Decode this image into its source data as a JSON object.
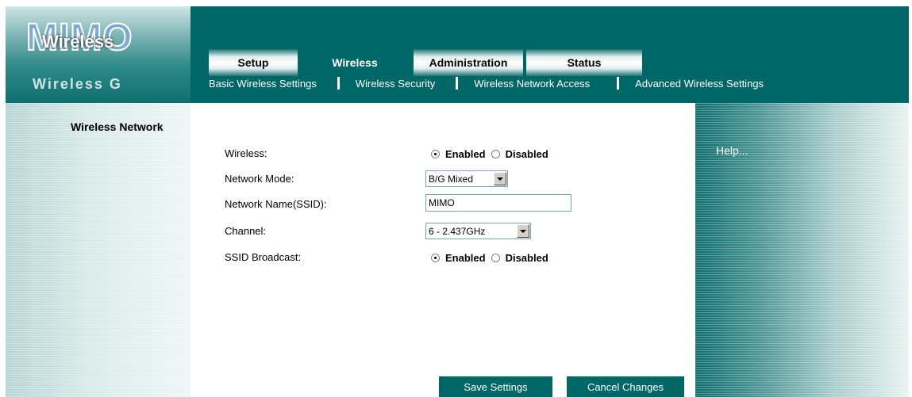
{
  "logo": {
    "big_text": "MIMO",
    "overlay_text": "Wireless",
    "subtitle": "Wireless G"
  },
  "tabs": [
    {
      "label": "Setup",
      "active": false
    },
    {
      "label": "Wireless",
      "active": true
    },
    {
      "label": "Administration",
      "active": false
    },
    {
      "label": "Status",
      "active": false
    }
  ],
  "subnav": [
    "Basic Wireless Settings",
    "Wireless Security",
    "Wireless Network Access",
    "Advanced Wireless Settings"
  ],
  "section_title": "Wireless Network",
  "help_label": "Help...",
  "form": {
    "wireless": {
      "label": "Wireless:",
      "options": [
        "Enabled",
        "Disabled"
      ],
      "selected": "Enabled"
    },
    "network_mode": {
      "label": "Network Mode:",
      "value": "B/G Mixed"
    },
    "ssid": {
      "label": "Network Name(SSID):",
      "value": "MIMO"
    },
    "channel": {
      "label": "Channel:",
      "value": "6 - 2.437GHz"
    },
    "ssid_broadcast": {
      "label": "SSID Broadcast:",
      "options": [
        "Enabled",
        "Disabled"
      ],
      "selected": "Enabled"
    }
  },
  "buttons": {
    "save": "Save Settings",
    "cancel": "Cancel Changes"
  },
  "colors": {
    "brand_teal": "#006666",
    "text": "#000000",
    "header_text": "#ffffff"
  }
}
